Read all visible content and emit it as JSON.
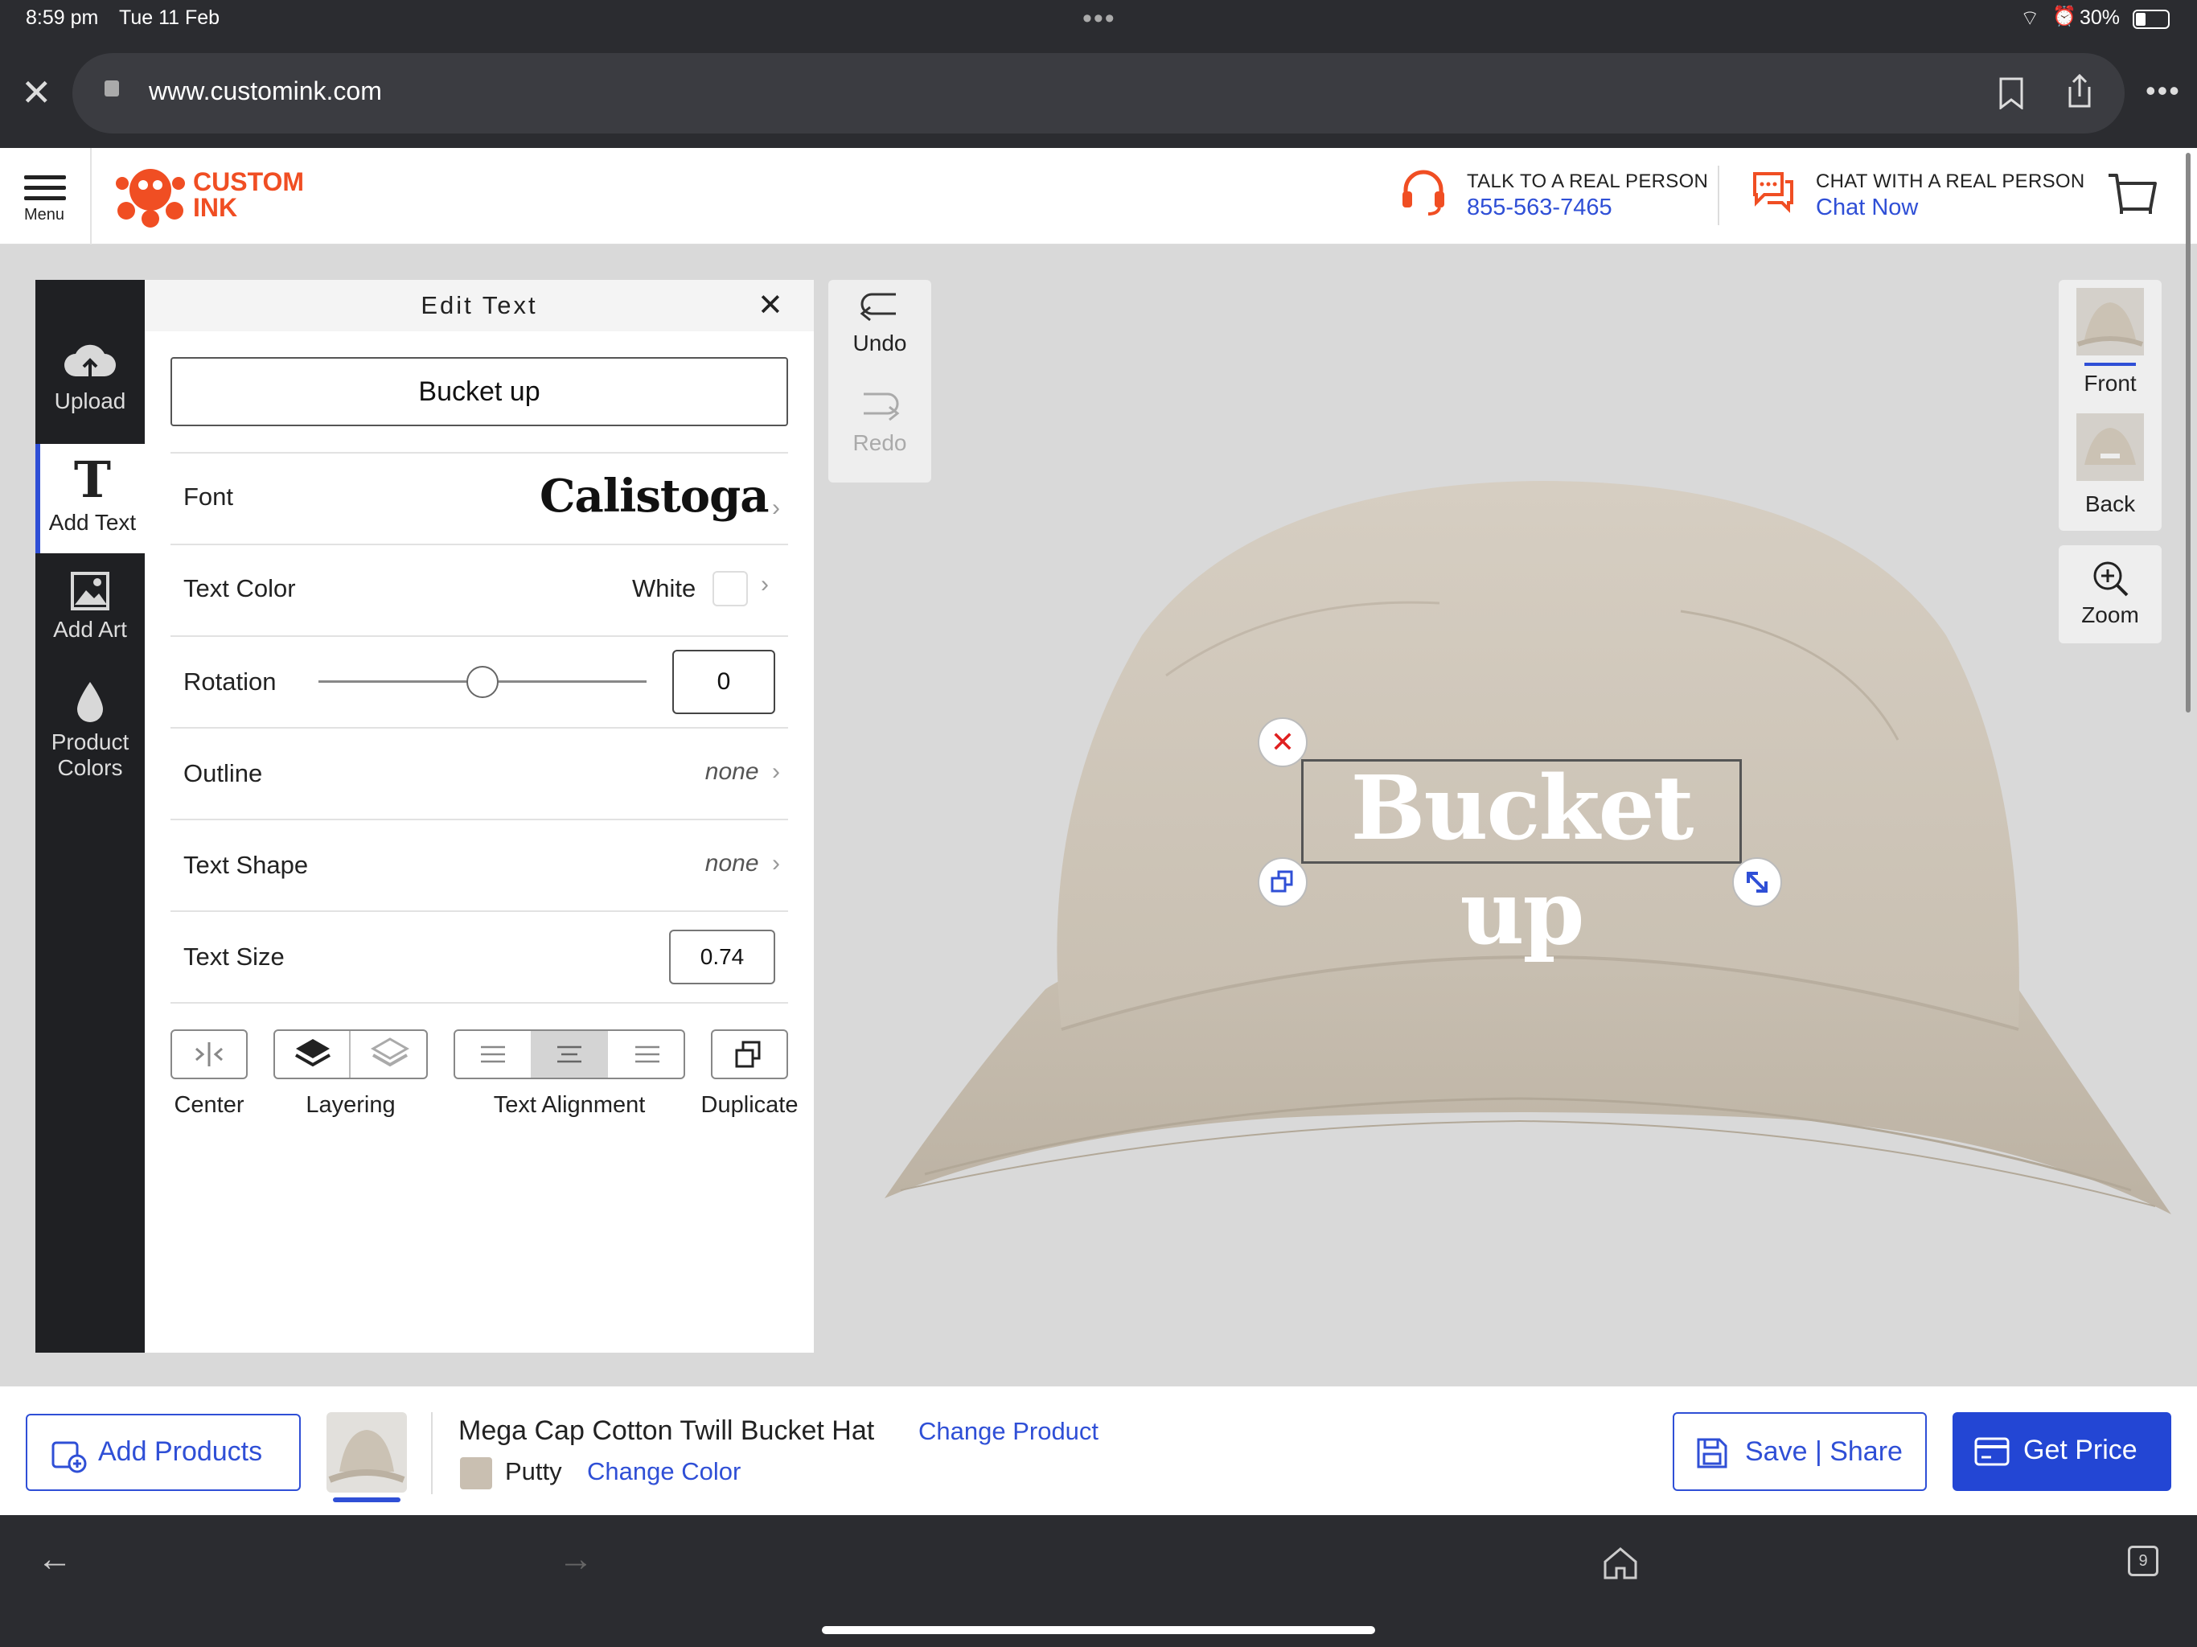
{
  "status_bar": {
    "time": "8:59 pm",
    "date": "Tue 11 Feb",
    "battery": "30%"
  },
  "browser": {
    "url": "www.customink.com"
  },
  "header": {
    "menu_label": "Menu",
    "logo_line1": "CUSTOM",
    "logo_line2": "INK",
    "talk_label": "TALK TO A REAL PERSON",
    "phone": "855-563-7465",
    "chat_label": "CHAT WITH A REAL PERSON",
    "chat_link": "Chat Now"
  },
  "tools": [
    {
      "label": "Upload"
    },
    {
      "label": "Add Text"
    },
    {
      "label": "Add Art"
    },
    {
      "label_line1": "Product",
      "label_line2": "Colors"
    }
  ],
  "edit_panel": {
    "title": "Edit Text",
    "text_value": "Bucket up",
    "font_label": "Font",
    "font_value": "Calistoga",
    "text_color_label": "Text Color",
    "text_color_value": "White",
    "rotation_label": "Rotation",
    "rotation_value": "0",
    "outline_label": "Outline",
    "outline_value": "none",
    "text_shape_label": "Text Shape",
    "text_shape_value": "none",
    "text_size_label": "Text Size",
    "text_size_value": "0.74",
    "center_label": "Center",
    "layering_label": "Layering",
    "alignment_label": "Text Alignment",
    "duplicate_label": "Duplicate"
  },
  "history": {
    "undo": "Undo",
    "redo": "Redo"
  },
  "views": {
    "front": "Front",
    "back": "Back",
    "zoom": "Zoom"
  },
  "canvas": {
    "design_text": "Bucket up"
  },
  "product_bar": {
    "add_products": "Add Products",
    "product_name": "Mega Cap Cotton Twill Bucket Hat",
    "change_product": "Change Product",
    "color_name": "Putty",
    "change_color": "Change Color",
    "save_share": "Save | Share",
    "get_price": "Get Price"
  },
  "colors": {
    "accent": "#2f4fd6",
    "brand": "#f04e23",
    "hat": "#cfc6b8",
    "swatch_putty": "#c9bfb1"
  },
  "tabs_count": "9"
}
